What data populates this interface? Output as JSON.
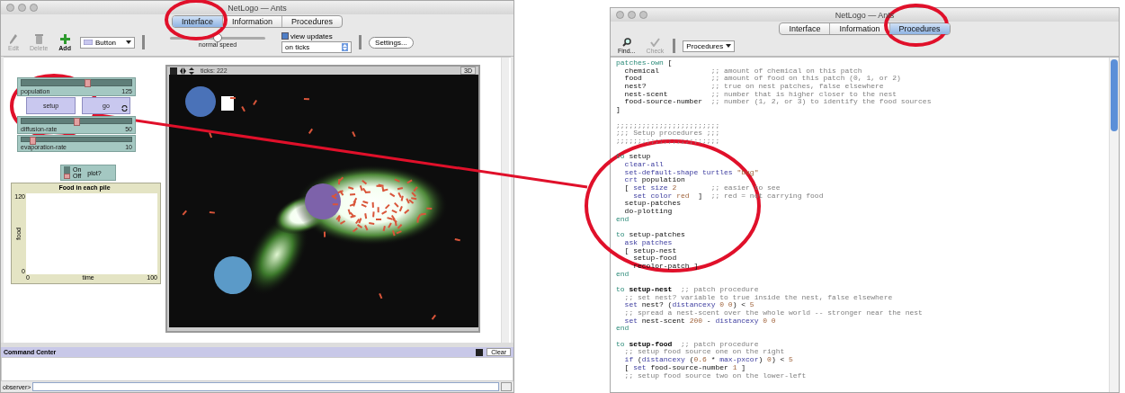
{
  "interface_window": {
    "title": "NetLogo — Ants",
    "tabs": [
      {
        "label": "Interface",
        "selected": true
      },
      {
        "label": "Information",
        "selected": false
      },
      {
        "label": "Procedures",
        "selected": false
      }
    ],
    "toolbar": {
      "tools": [
        {
          "label": "Edit",
          "disabled": true
        },
        {
          "label": "Delete",
          "disabled": true
        },
        {
          "label": "Add",
          "disabled": false
        }
      ],
      "widget_menu": "Button",
      "speed": {
        "level": 0.5,
        "label": "normal speed"
      },
      "view_updates": {
        "label": "view updates",
        "checked": true
      },
      "update_mode": "on ticks",
      "settings_button": "Settings..."
    },
    "widgets": [
      {
        "kind": "slider",
        "label": "population",
        "value": "125",
        "level": 0.6
      },
      {
        "kind": "button",
        "label": "setup",
        "forever": false
      },
      {
        "kind": "button",
        "label": "go",
        "forever": true
      },
      {
        "kind": "slider",
        "label": "diffusion-rate",
        "value": "50",
        "level": 0.5
      },
      {
        "kind": "slider",
        "label": "evaporation-rate",
        "value": "10",
        "level": 0.1
      },
      {
        "kind": "switch",
        "on_label": "On",
        "off_label": "Off",
        "label": "plot?",
        "on": false
      },
      {
        "kind": "plot",
        "title": "Food in each pile",
        "ylabel": "food",
        "xlabel": "time",
        "ymax": "120",
        "ymin": "0",
        "xmin": "0",
        "xmax": "100"
      }
    ],
    "view": {
      "ticks": "ticks: 222",
      "three_d_button": "3D"
    },
    "command_center": {
      "title": "Command Center",
      "clear_button": "Clear",
      "prompt": "observer>"
    }
  },
  "code_window": {
    "title": "NetLogo — Ants",
    "tabs": [
      {
        "label": "Interface",
        "selected": false
      },
      {
        "label": "Information",
        "selected": false
      },
      {
        "label": "Procedures",
        "selected": true
      }
    ],
    "toolbar": {
      "find": {
        "label": "Find...",
        "disabled": false
      },
      "check": {
        "label": "Check",
        "disabled": true
      },
      "procedures_menu": "Procedures"
    },
    "code_blocks": [
      [
        [
          {
            "kind": "keyword",
            "text": "patches-own"
          },
          {
            "kind": "plain",
            "text": " ["
          }
        ],
        [
          {
            "kind": "plain",
            "text": "  chemical            "
          },
          {
            "kind": "comment",
            "text": ";; amount of chemical on this patch"
          }
        ],
        [
          {
            "kind": "plain",
            "text": "  food                "
          },
          {
            "kind": "comment",
            "text": ";; amount of food on this patch (0, 1, or 2)"
          }
        ],
        [
          {
            "kind": "plain",
            "text": "  nest?               "
          },
          {
            "kind": "comment",
            "text": ";; true on nest patches, false elsewhere"
          }
        ],
        [
          {
            "kind": "plain",
            "text": "  nest-scent          "
          },
          {
            "kind": "comment",
            "text": ";; number that is higher closer to the nest"
          }
        ],
        [
          {
            "kind": "plain",
            "text": "  food-source-number  "
          },
          {
            "kind": "comment",
            "text": ";; number (1, 2, or 3) to identify the food sources"
          }
        ],
        [
          {
            "kind": "plain",
            "text": "]"
          }
        ]
      ],
      [
        [
          {
            "kind": "comment",
            "text": ";;;;;;;;;;;;;;;;;;;;;;;;"
          }
        ],
        [
          {
            "kind": "comment",
            "text": ";;; Setup procedures ;;;"
          }
        ],
        [
          {
            "kind": "comment",
            "text": ";;;;;;;;;;;;;;;;;;;;;;;;"
          }
        ]
      ],
      [
        [
          {
            "kind": "keyword",
            "text": "to"
          },
          {
            "kind": "plain",
            "text": " setup"
          }
        ],
        [
          {
            "kind": "primitive",
            "text": "  clear-all"
          }
        ],
        [
          {
            "kind": "primitive",
            "text": "  set-default-shape turtles "
          },
          {
            "kind": "constant",
            "text": "\"bug\""
          }
        ],
        [
          {
            "kind": "primitive",
            "text": "  crt"
          },
          {
            "kind": "plain",
            "text": " population"
          }
        ],
        [
          {
            "kind": "plain",
            "text": "  [ "
          },
          {
            "kind": "primitive",
            "text": "set size "
          },
          {
            "kind": "constant",
            "text": "2"
          },
          {
            "kind": "comment",
            "text": "        ;; easier to see"
          }
        ],
        [
          {
            "kind": "primitive",
            "text": "    set color "
          },
          {
            "kind": "constant",
            "text": "red"
          },
          {
            "kind": "plain",
            "text": "  ]  "
          },
          {
            "kind": "comment",
            "text": ";; red = not carrying food"
          }
        ],
        [
          {
            "kind": "plain",
            "text": "  setup-patches"
          }
        ],
        [
          {
            "kind": "plain",
            "text": "  do-plotting"
          }
        ],
        [
          {
            "kind": "keyword",
            "text": "end"
          }
        ]
      ],
      [
        [
          {
            "kind": "keyword",
            "text": "to"
          },
          {
            "kind": "plain",
            "text": " setup-patches"
          }
        ],
        [
          {
            "kind": "primitive",
            "text": "  ask patches"
          }
        ],
        [
          {
            "kind": "plain",
            "text": "  [ setup-nest"
          }
        ],
        [
          {
            "kind": "plain",
            "text": "    setup-food"
          }
        ],
        [
          {
            "kind": "plain",
            "text": "    recolor-patch ]"
          }
        ],
        [
          {
            "kind": "keyword",
            "text": "end"
          }
        ]
      ],
      [
        [
          {
            "kind": "keyword",
            "text": "to"
          },
          {
            "kind": "name",
            "text": " setup-nest"
          },
          {
            "kind": "comment",
            "text": "  ;; patch procedure"
          }
        ],
        [
          {
            "kind": "comment",
            "text": "  ;; set nest? variable to true inside the nest, false elsewhere"
          }
        ],
        [
          {
            "kind": "primitive",
            "text": "  set"
          },
          {
            "kind": "plain",
            "text": " nest? ("
          },
          {
            "kind": "primitive",
            "text": "distancexy "
          },
          {
            "kind": "constant",
            "text": "0 0"
          },
          {
            "kind": "plain",
            "text": ") < "
          },
          {
            "kind": "constant",
            "text": "5"
          }
        ],
        [
          {
            "kind": "comment",
            "text": "  ;; spread a nest-scent over the whole world -- stronger near the nest"
          }
        ],
        [
          {
            "kind": "primitive",
            "text": "  set"
          },
          {
            "kind": "plain",
            "text": " nest-scent "
          },
          {
            "kind": "constant",
            "text": "200"
          },
          {
            "kind": "plain",
            "text": " - "
          },
          {
            "kind": "primitive",
            "text": "distancexy "
          },
          {
            "kind": "constant",
            "text": "0 0"
          }
        ],
        [
          {
            "kind": "keyword",
            "text": "end"
          }
        ]
      ],
      [
        [
          {
            "kind": "keyword",
            "text": "to"
          },
          {
            "kind": "name",
            "text": " setup-food"
          },
          {
            "kind": "comment",
            "text": "  ;; patch procedure"
          }
        ],
        [
          {
            "kind": "comment",
            "text": "  ;; setup food source one on the right"
          }
        ],
        [
          {
            "kind": "primitive",
            "text": "  if"
          },
          {
            "kind": "plain",
            "text": " ("
          },
          {
            "kind": "primitive",
            "text": "distancexy"
          },
          {
            "kind": "plain",
            "text": " ("
          },
          {
            "kind": "constant",
            "text": "0.6"
          },
          {
            "kind": "plain",
            "text": " * "
          },
          {
            "kind": "primitive",
            "text": "max-pxcor"
          },
          {
            "kind": "plain",
            "text": ") "
          },
          {
            "kind": "constant",
            "text": "0"
          },
          {
            "kind": "plain",
            "text": ") < "
          },
          {
            "kind": "constant",
            "text": "5"
          }
        ],
        [
          {
            "kind": "plain",
            "text": "  [ "
          },
          {
            "kind": "primitive",
            "text": "set"
          },
          {
            "kind": "plain",
            "text": " food-source-number "
          },
          {
            "kind": "constant",
            "text": "1"
          },
          {
            "kind": "plain",
            "text": " ]"
          }
        ],
        [
          {
            "kind": "comment",
            "text": "  ;; setup food source two on the lower-left"
          }
        ]
      ]
    ]
  }
}
